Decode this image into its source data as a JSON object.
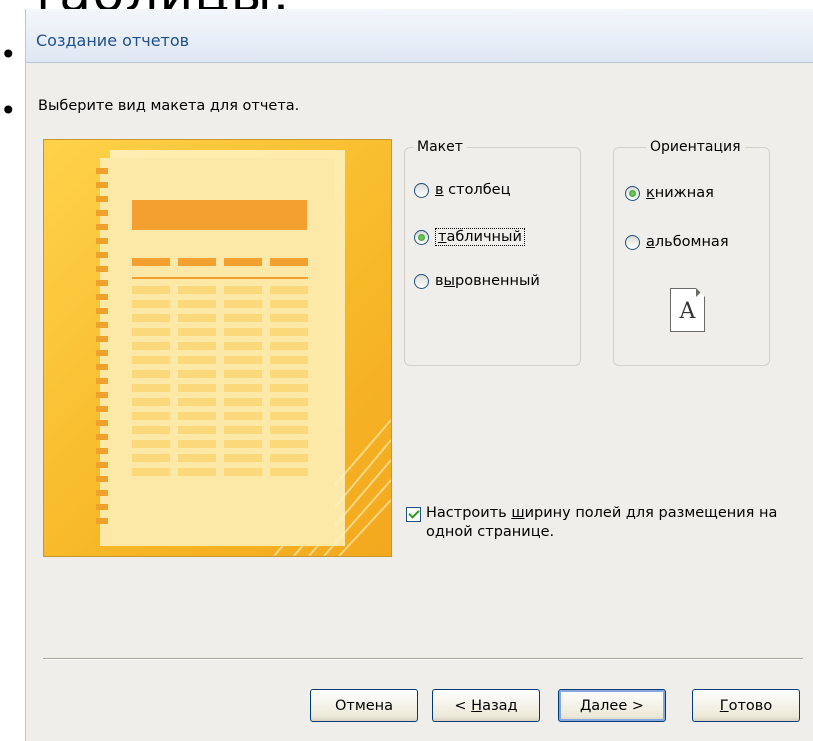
{
  "background": {
    "title": "таблицы.",
    "bullets": [
      "•",
      "•"
    ]
  },
  "dialog": {
    "title": "Создание отчетов",
    "instruction": "Выберите вид макета для отчета.",
    "layout_group": {
      "legend": "Макет",
      "options": [
        {
          "prefix": "",
          "accel": "в",
          "rest": " столбец",
          "checked": false
        },
        {
          "prefix": "",
          "accel": "т",
          "rest": "абличный",
          "checked": true
        },
        {
          "prefix": "в",
          "accel": "ы",
          "rest": "ровненный",
          "checked": false
        }
      ]
    },
    "orientation_group": {
      "legend": "Ориентация",
      "options": [
        {
          "accel": "к",
          "rest": "нижная",
          "checked": true
        },
        {
          "accel": "а",
          "rest": "льбомная",
          "checked": false
        }
      ],
      "page_icon_letter": "A"
    },
    "fit_checkbox": {
      "label": "Настроить ширину полей для размещения на одной странице.",
      "label_pre": "Настроить ",
      "label_accel": "ш",
      "label_post": "ирину полей для размещения на одной странице.",
      "checked": true
    },
    "buttons": {
      "cancel": "Отмена",
      "back_pre": "< ",
      "back_accel": "Н",
      "back_rest": "азад",
      "next_accel": "Д",
      "next_rest": "алее >",
      "finish_accel": "Г",
      "finish_rest": "отово"
    }
  },
  "colors": {
    "preview_gold": "#f7b828",
    "title_blue": "#1f4e8c",
    "radio_green": "#2f9a1e"
  }
}
